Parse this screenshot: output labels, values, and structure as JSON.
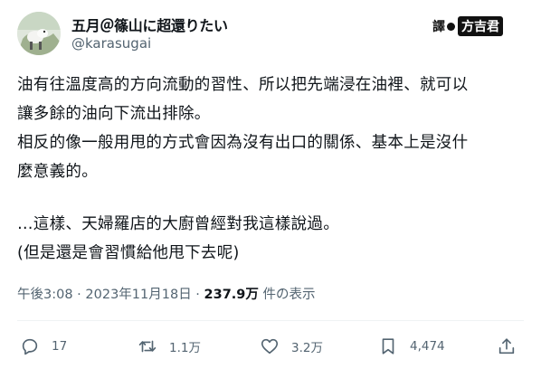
{
  "user": {
    "display_name": "五月＠篠山に超還りたい",
    "handle": "@karasugai"
  },
  "watermark": {
    "part1": "譯",
    "part2": "方吉君"
  },
  "tweet": {
    "lines": [
      "油有往溫度高的方向流動的習性、所以把先端浸在油裡、就可以",
      "讓多餘的油向下流出排除。",
      "相反的像一般用甩的方式會因為沒有出口的關係、基本上是沒什",
      "麼意義的。",
      "",
      "…這樣、天婦羅店的大廚曾經對我這樣說過。",
      "(但是還是會習慣給他甩下去呢)"
    ]
  },
  "meta": {
    "time": "午後3:08",
    "sep1": " · ",
    "date": "2023年11月18日",
    "sep2": " · ",
    "views": "237.9万",
    "views_suffix": " 件の表示"
  },
  "actions": {
    "reply": {
      "icon": "reply-icon",
      "count": "17"
    },
    "retweet": {
      "icon": "retweet-icon",
      "count": "1.1万"
    },
    "like": {
      "icon": "heart-icon",
      "count": "3.2万"
    },
    "bookmark": {
      "icon": "bookmark-icon",
      "count": "4,474"
    },
    "share": {
      "icon": "share-icon"
    }
  },
  "colors": {
    "text": "#0f1419",
    "secondary": "#536471",
    "divider": "#eff3f4"
  }
}
